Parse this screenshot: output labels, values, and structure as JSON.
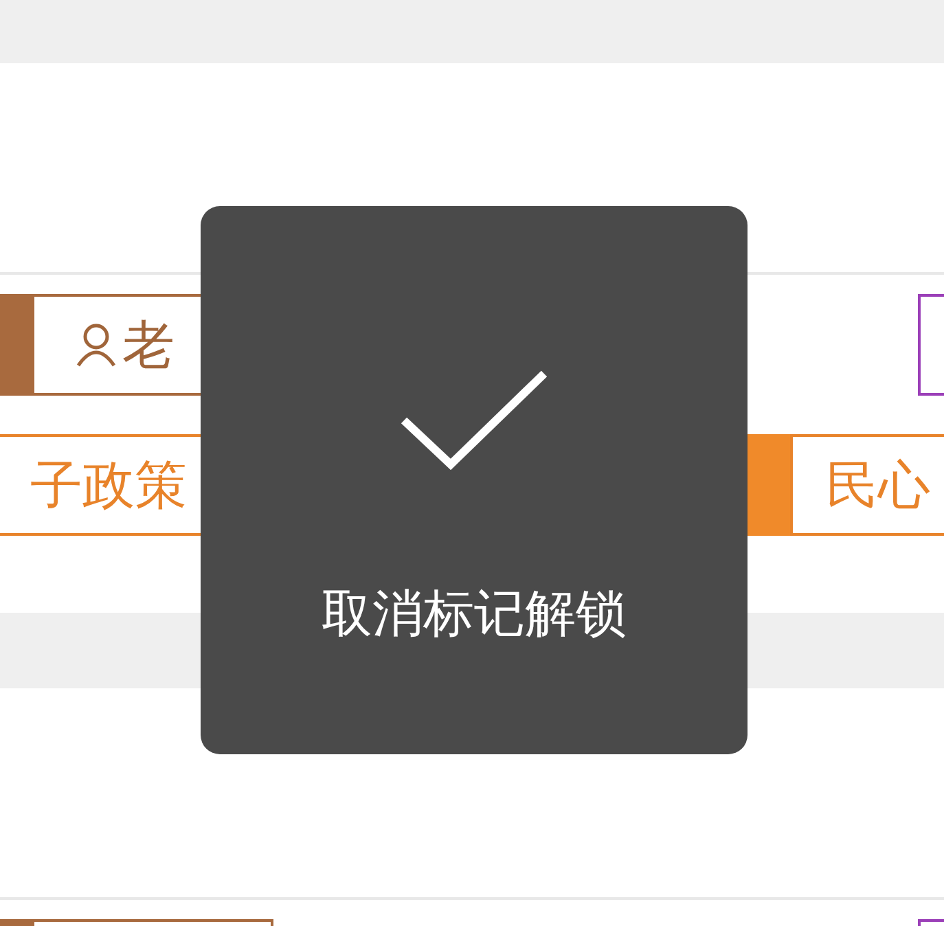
{
  "cards": [
    {
      "rows": [
        {
          "tags": [
            {
              "kind": "author",
              "text": "老"
            },
            {
              "kind": "outline"
            }
          ]
        },
        {
          "tags": [
            {
              "kind": "topic",
              "text": "子政策"
            },
            {
              "kind": "topic",
              "text": "民心"
            }
          ]
        }
      ]
    },
    {
      "rows": [
        {
          "tags": [
            {
              "kind": "author"
            },
            {
              "kind": "outline"
            }
          ]
        }
      ]
    }
  ],
  "toast": {
    "message": "取消标记解锁"
  }
}
